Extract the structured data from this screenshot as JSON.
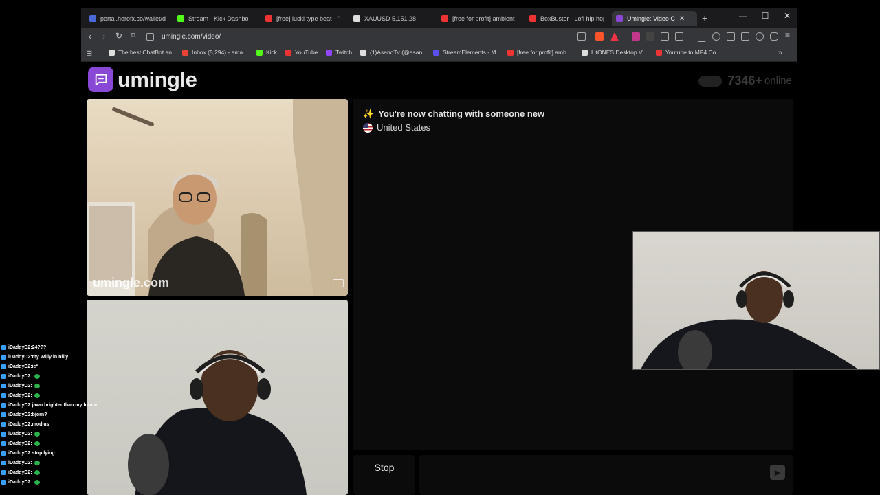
{
  "browser": {
    "tabs": [
      {
        "label": "portal.herofx.co/wallet/d",
        "color": "#4a6ad8"
      },
      {
        "label": "Stream - Kick Dashbo",
        "color": "#53fc18"
      },
      {
        "label": "[free] lucki type beat - \"c",
        "color": "#e33"
      },
      {
        "label": "XAUUSD 5,151.28",
        "color": "#ddd"
      },
      {
        "label": "[free for profit] ambient",
        "color": "#e33"
      },
      {
        "label": "BoxBuster - Lofi hip hop",
        "color": "#e33"
      },
      {
        "label": "Umingle: Video C",
        "color": "#8a48d6"
      }
    ],
    "url": "umingle.com/video/",
    "bookmarks": [
      {
        "label": "The best ChatBot an...",
        "color": "#ddd"
      },
      {
        "label": "Inbox (5,294) - ama...",
        "color": "#ea4335"
      },
      {
        "label": "Kick",
        "color": "#53fc18"
      },
      {
        "label": "YouTube",
        "color": "#e33"
      },
      {
        "label": "Twitch",
        "color": "#9146ff"
      },
      {
        "label": "(1)AsanoTv (@asan...",
        "color": "#ddd"
      },
      {
        "label": "StreamElements - M...",
        "color": "#5a4ff0"
      },
      {
        "label": "[free for profit] amb...",
        "color": "#e33"
      },
      {
        "label": "LitONES Desktop Vi...",
        "color": "#ddd"
      },
      {
        "label": "Youtube to MP4 Co...",
        "color": "#e33"
      }
    ]
  },
  "app": {
    "logo": "umingle",
    "online_count": "7346+",
    "online_label": "online",
    "watermark": "umingle.com"
  },
  "chat": {
    "status_icon": "✨",
    "status": "You're now chatting with someone new",
    "country": "United States"
  },
  "controls": {
    "stop_label": "Stop"
  },
  "stream_chat": [
    {
      "user": "iDaddyD2",
      "text": "24???"
    },
    {
      "user": "iDaddyD2",
      "text": "my Willy in nilly"
    },
    {
      "user": "iDaddyD2",
      "text": "ie*"
    },
    {
      "user": "iDaddyD2",
      "text": ""
    },
    {
      "user": "iDaddyD2",
      "text": ""
    },
    {
      "user": "iDaddyD2",
      "text": ""
    },
    {
      "user": "iDaddyD2",
      "text": "jawn brighter than my future"
    },
    {
      "user": "iDaddyD2",
      "text": "bjorn?"
    },
    {
      "user": "iDaddyD2",
      "text": "modius"
    },
    {
      "user": "iDaddyD2",
      "text": ""
    },
    {
      "user": "iDaddyD2",
      "text": ""
    },
    {
      "user": "iDaddyD2",
      "text": "stop lying"
    },
    {
      "user": "iDaddyD2",
      "text": ""
    },
    {
      "user": "iDaddyD2",
      "text": ""
    },
    {
      "user": "iDaddyD2",
      "text": ""
    }
  ]
}
